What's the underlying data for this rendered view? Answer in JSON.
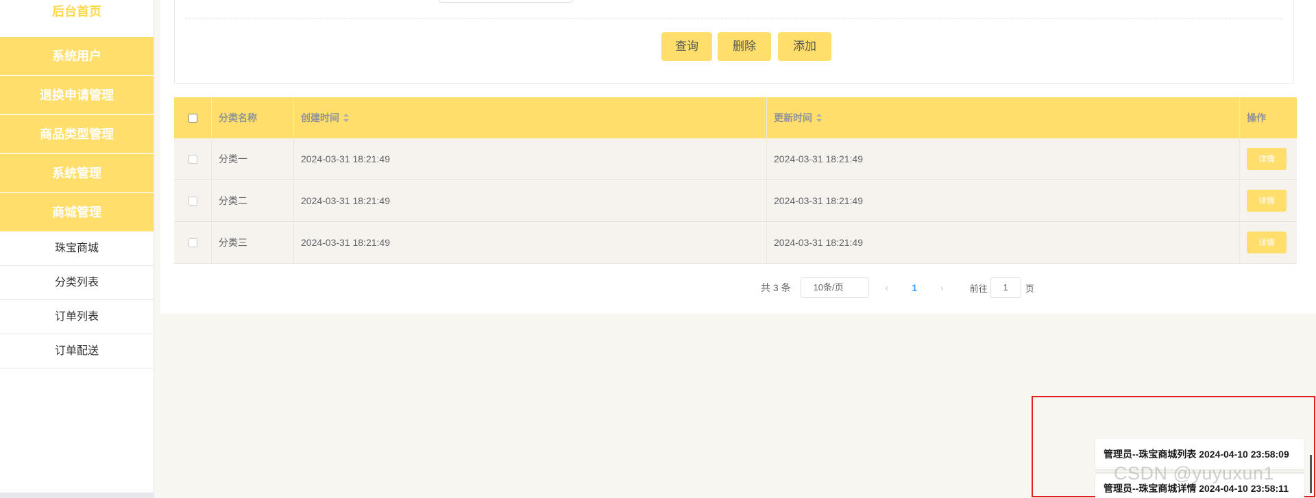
{
  "sidebar": {
    "home_label": "后台首页",
    "menu": [
      {
        "label": "系统用户"
      },
      {
        "label": "退换申请管理"
      },
      {
        "label": "商品类型管理"
      },
      {
        "label": "系统管理"
      },
      {
        "label": "商城管理"
      }
    ],
    "submenu": [
      {
        "label": "珠宝商城"
      },
      {
        "label": "分类列表"
      },
      {
        "label": "订单列表"
      },
      {
        "label": "订单配送"
      }
    ]
  },
  "toolbar": {
    "query_label": "查询",
    "delete_label": "删除",
    "add_label": "添加"
  },
  "table": {
    "headers": {
      "name": "分类名称",
      "created": "创建时间",
      "updated": "更新时间",
      "actions": "操作"
    },
    "rows": [
      {
        "name": "分类一",
        "created": "2024-03-31 18:21:49",
        "updated": "2024-03-31 18:21:49",
        "action": "详情"
      },
      {
        "name": "分类二",
        "created": "2024-03-31 18:21:49",
        "updated": "2024-03-31 18:21:49",
        "action": "详情"
      },
      {
        "name": "分类三",
        "created": "2024-03-31 18:21:49",
        "updated": "2024-03-31 18:21:49",
        "action": "详情"
      }
    ]
  },
  "pagination": {
    "total": "共 3 条",
    "page_size": "10条/页",
    "prev_icon": "chevron-left-icon",
    "current_page": "1",
    "next_icon": "chevron-right-icon",
    "goto_label": "前往",
    "goto_value": "1",
    "goto_unit": "页"
  },
  "notifications": [
    {
      "text": "管理员--珠宝商城列表 2024-04-10 23:58:09"
    },
    {
      "text": "管理员--珠宝商城详情 2024-04-10 23:58:11"
    }
  ],
  "watermark": "CSDN @yuyuxun1",
  "colors": {
    "accent": "#ffde6b",
    "row_bg": "#f6f3ef",
    "highlight_border": "#e02020",
    "page_link": "#409eff"
  }
}
